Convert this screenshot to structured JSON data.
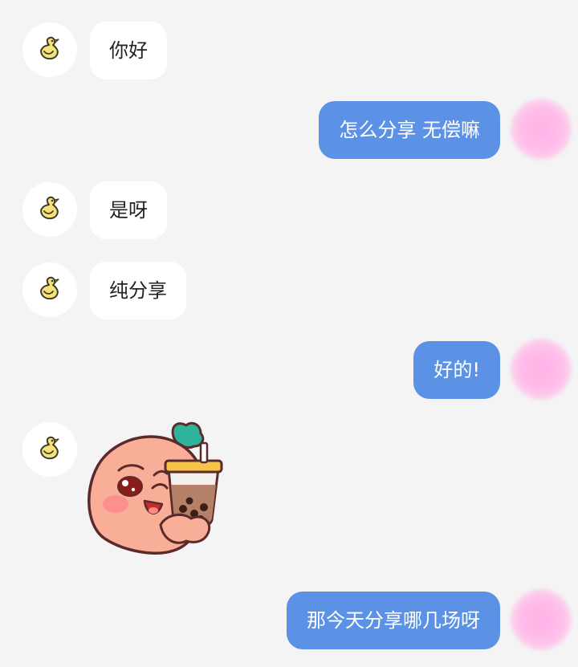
{
  "conversation": {
    "messages": [
      {
        "direction": "incoming",
        "type": "text",
        "text": "你好"
      },
      {
        "direction": "outgoing",
        "type": "text",
        "text": "怎么分享 无偿嘛"
      },
      {
        "direction": "incoming",
        "type": "text",
        "text": "是呀"
      },
      {
        "direction": "incoming",
        "type": "text",
        "text": "纯分享"
      },
      {
        "direction": "outgoing",
        "type": "text",
        "text": "好的!"
      },
      {
        "direction": "incoming",
        "type": "sticker",
        "sticker": "peach-bubble-tea-sticker"
      },
      {
        "direction": "outgoing",
        "type": "text",
        "text": "那今天分享哪几场呀"
      }
    ]
  },
  "avatars": {
    "incoming_icon": "duck-avatar-icon",
    "outgoing_icon": "pink-blurred-avatar"
  },
  "colors": {
    "background": "#f4f4f4",
    "incoming_bubble": "#ffffff",
    "outgoing_bubble": "#5b92e6",
    "incoming_text": "#222222",
    "outgoing_text": "#ffffff",
    "avatar_pink": "#ffbfea"
  }
}
